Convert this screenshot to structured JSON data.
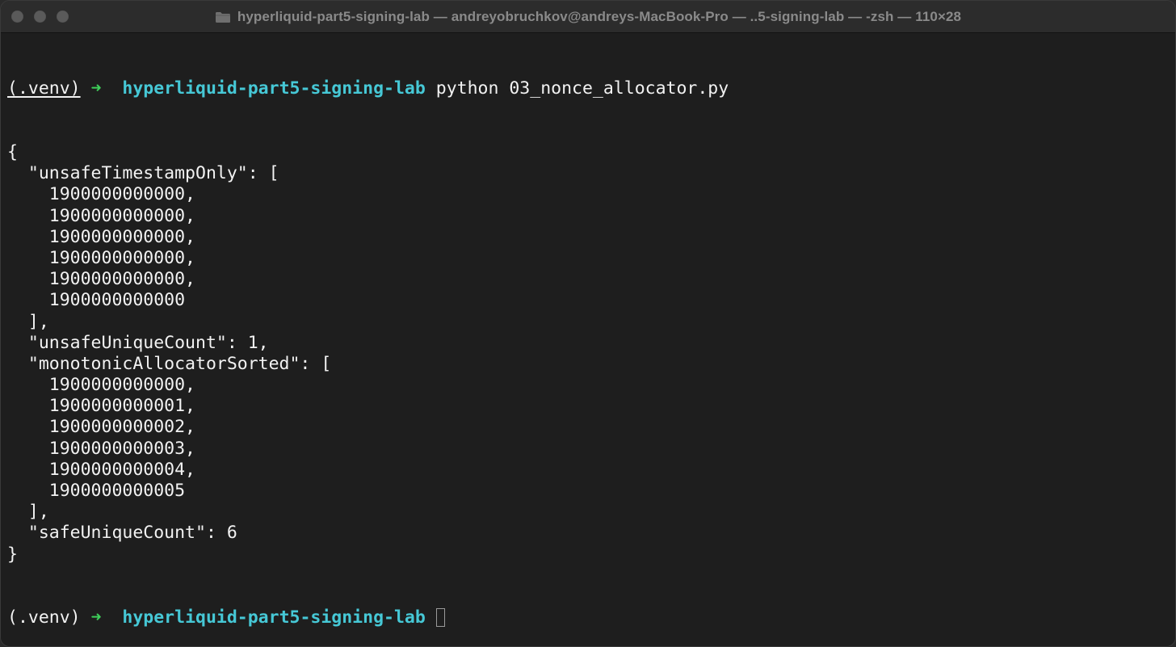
{
  "window": {
    "title": "hyperliquid-part5-signing-lab — andreyobruchkov@andreys-MacBook-Pro — ..5-signing-lab — -zsh — 110×28"
  },
  "prompt": {
    "venv": "(.venv)",
    "arrow": "➜",
    "cwd": "hyperliquid-part5-signing-lab"
  },
  "command": "python 03_nonce_allocator.py",
  "output": [
    "{",
    "  \"unsafeTimestampOnly\": [",
    "    1900000000000,",
    "    1900000000000,",
    "    1900000000000,",
    "    1900000000000,",
    "    1900000000000,",
    "    1900000000000",
    "  ],",
    "  \"unsafeUniqueCount\": 1,",
    "  \"monotonicAllocatorSorted\": [",
    "    1900000000000,",
    "    1900000000001,",
    "    1900000000002,",
    "    1900000000003,",
    "    1900000000004,",
    "    1900000000005",
    "  ],",
    "  \"safeUniqueCount\": 6",
    "}"
  ],
  "colors": {
    "background": "#1e1e1e",
    "text": "#f2f2f2",
    "arrow": "#3ecf5a",
    "cwd": "#46c8d6"
  }
}
